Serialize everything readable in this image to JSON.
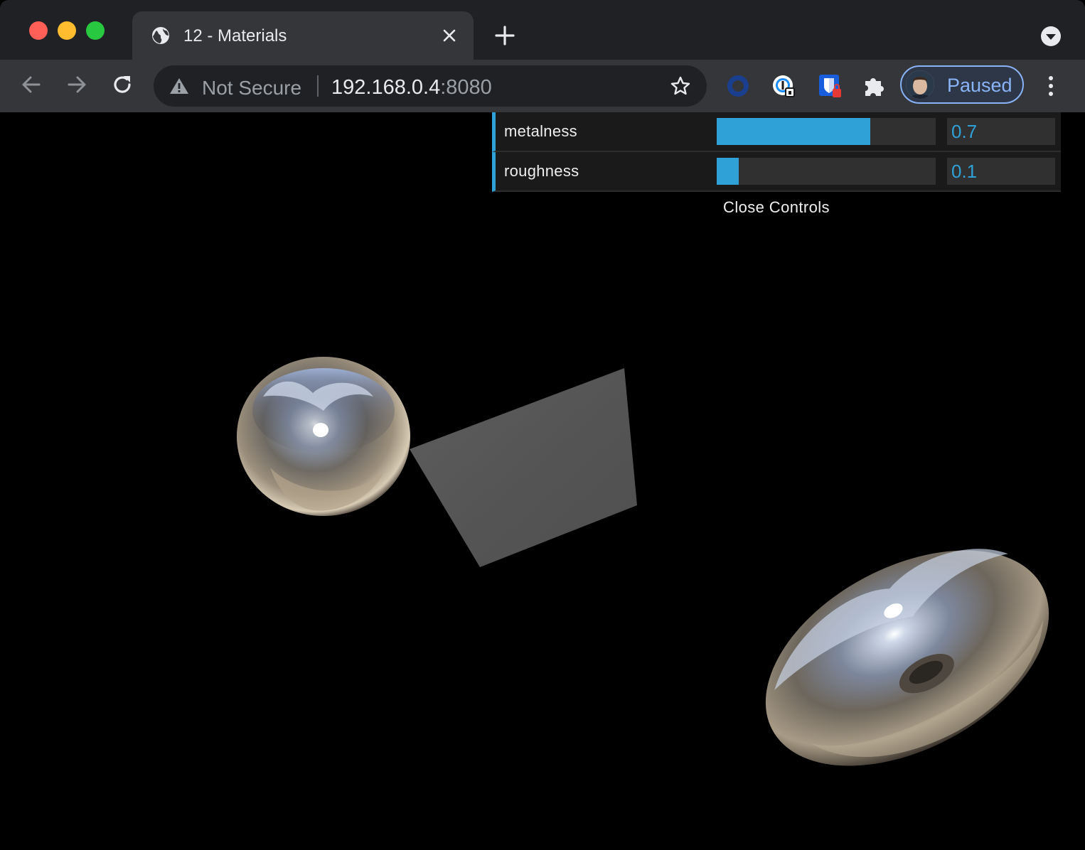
{
  "browser": {
    "tab": {
      "title": "12 - Materials"
    },
    "address": {
      "security_label": "Not Secure",
      "host": "192.168.0.4",
      "port": ":8080"
    },
    "profile": {
      "label": "Paused"
    }
  },
  "gui": {
    "controls": [
      {
        "label": "metalness",
        "value": "0.7",
        "fraction": 0.7
      },
      {
        "label": "roughness",
        "value": "0.1",
        "fraction": 0.1
      }
    ],
    "close_label": "Close Controls"
  },
  "colors": {
    "accent": "#2fa1d6",
    "profile_accent": "#8ab4f8"
  },
  "icons": {
    "tab": "globe-icon",
    "tab_close": "close-icon",
    "new_tab": "plus-icon",
    "tab_search": "chevron-down-icon",
    "back": "back-arrow-icon",
    "forward": "forward-arrow-icon",
    "reload": "reload-icon",
    "warning": "warning-icon",
    "bookmark": "star-icon",
    "extensions": [
      "opera-circle-icon",
      "onepassword-icon",
      "bitwarden-icon",
      "puzzle-icon"
    ],
    "menu": "kebab-menu-icon"
  }
}
